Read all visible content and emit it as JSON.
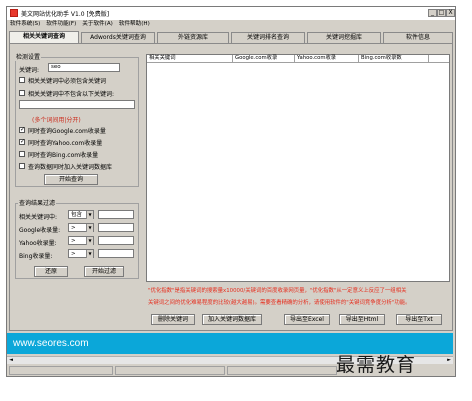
{
  "window": {
    "title": "美文网站优化助手 V1.0 [免费版]",
    "minimize": "_",
    "maximize": "□",
    "close": "X"
  },
  "menu": [
    "软件系统(S)",
    "软件功能(F)",
    "关于软件(A)",
    "软件帮助(H)"
  ],
  "tabs": [
    "相关关键词查询",
    "Adwords关键词查询",
    "外链资源库",
    "关键词排名查询",
    "关键词挖掘库",
    "软件信息"
  ],
  "search_settings": {
    "title": "检测设置",
    "keyword_label": "关键词:",
    "keyword_value": "seo",
    "must_contain_label": "相关关键词中必须包含关键词",
    "not_contain_label": "相关关键词中不包含以下关键词:",
    "hint": "(多个词间用|分开)",
    "google_label": "同时查询Google.com收录量",
    "yahoo_label": "同时查询Yahoo.com收录量",
    "bing_label": "同时查询Bing.com收录量",
    "add_db_label": "查询数据同时加入关键词数据库",
    "start_button": "开始查询"
  },
  "filter": {
    "title": "查询结果过滤",
    "rows": [
      {
        "label": "相关关键词中:",
        "option": "包含"
      },
      {
        "label": "Google收录量:",
        "option": ">"
      },
      {
        "label": "Yahoo收录量:",
        "option": ">"
      },
      {
        "label": "Bing收录量:",
        "option": ">"
      }
    ],
    "reset_button": "还原",
    "filter_button": "开始过滤"
  },
  "results_table": {
    "columns": [
      "相关关键词",
      "Google.com收录",
      "Yahoo.com收录",
      "Bing.com收录数"
    ]
  },
  "notice": {
    "line1": "\"优化指数\"是指关键词的搜索量x10000/关键词的百度收录网页量，\"优化指数\"从一定意义上反应了一组相关",
    "line2": "关键词之间的优化难易程度的比较(越大越易)。需要查看精确的分析，请使用软件的\"关键词竞争度分析\"功能。"
  },
  "actions": {
    "delete": "删除关键词",
    "add_db": "加入关键词数据库",
    "export_excel": "导出至Excel",
    "export_html": "导出至Html",
    "export_txt": "导出至Txt"
  },
  "banner": {
    "url": "www.seores.com"
  },
  "watermark": "最需教育",
  "colors": {
    "banner": "#0ba7d9",
    "notice": "#e62e1e",
    "app_icon": "#e8382c"
  }
}
